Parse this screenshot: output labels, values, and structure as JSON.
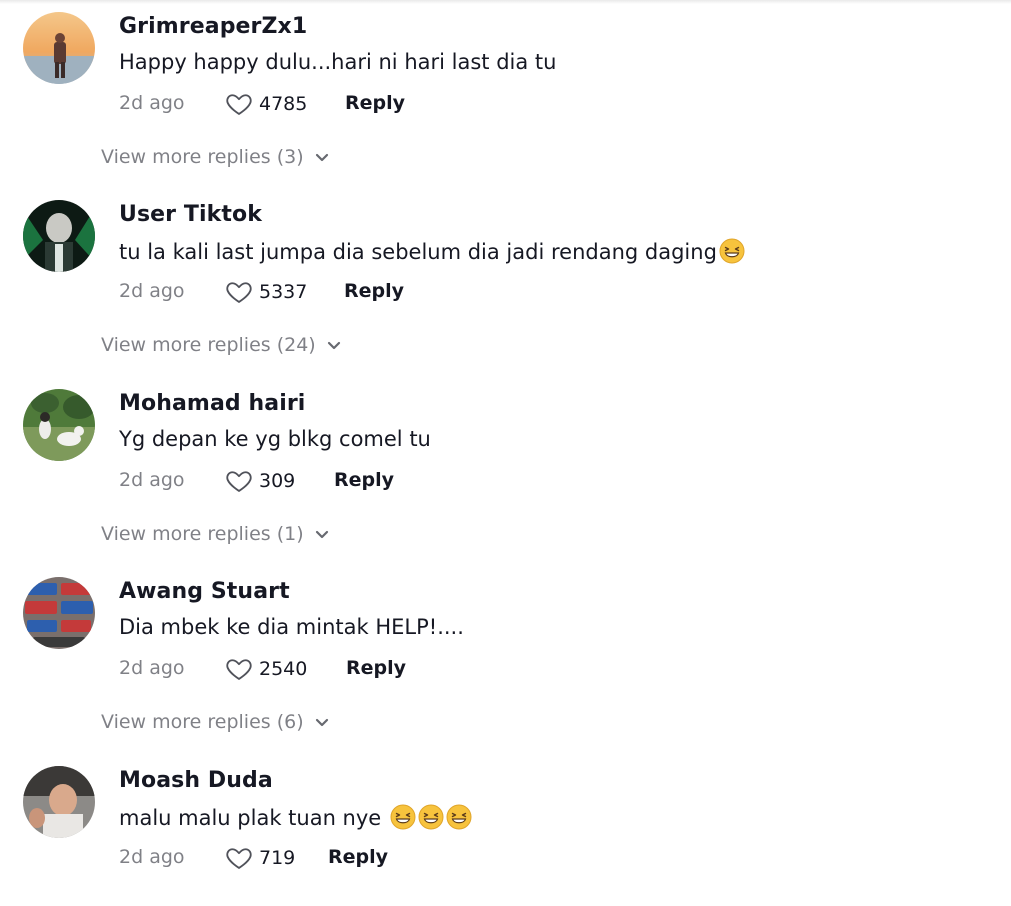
{
  "comments": [
    {
      "username": "GrimreaperZx1",
      "text": "Happy happy dulu...hari ni hari last dia tu",
      "emojis": [],
      "time": "2d ago",
      "likes": "4785",
      "reply_label": "Reply",
      "view_more": "View more replies (3)"
    },
    {
      "username": "User Tiktok",
      "text": "tu la kali last jumpa dia sebelum dia jadi rendang daging",
      "emojis": [
        "grinning-squinting-face"
      ],
      "time": "2d ago",
      "likes": "5337",
      "reply_label": "Reply",
      "view_more": "View more replies (24)"
    },
    {
      "username": "Mohamad hairi",
      "text": "Yg depan ke yg blkg comel tu",
      "emojis": [],
      "time": "2d ago",
      "likes": "309",
      "reply_label": "Reply",
      "view_more": "View more replies (1)"
    },
    {
      "username": "Awang Stuart",
      "text": "Dia mbek ke dia mintak HELP!....",
      "emojis": [],
      "time": "2d ago",
      "likes": "2540",
      "reply_label": "Reply",
      "view_more": "View more replies (6)"
    },
    {
      "username": "Moash Duda",
      "text": "malu malu plak tuan nye ",
      "emojis": [
        "grinning-squinting-face",
        "grinning-squinting-face",
        "grinning-squinting-face"
      ],
      "time": "2d ago",
      "likes": "719",
      "reply_label": "Reply",
      "view_more": ""
    }
  ],
  "colors": {
    "primary_text": "#161823",
    "secondary_text": "#8a8b91",
    "emoji_face": "#f7c33d"
  },
  "icons": {
    "like": "heart-outline-icon",
    "expand": "chevron-down-icon"
  }
}
